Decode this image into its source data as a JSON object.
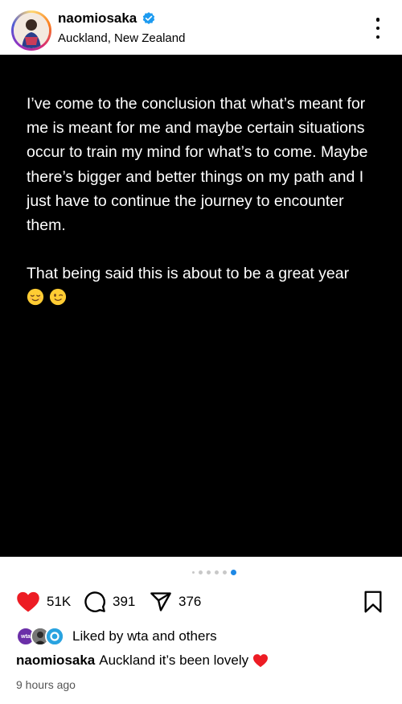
{
  "header": {
    "username": "naomiosaka",
    "location": "Auckland, New Zealand",
    "verified_icon": "verified-badge-icon",
    "more_icon": "more-vertical-icon"
  },
  "post": {
    "text": "I’ve come to the conclusion that what’s meant for me is meant for me and maybe certain situations occur to train my mind for what’s to come. Maybe there’s bigger and better things on my path and I just have to continue the journey to encounter them.\n\nThat being said this is about to be a great year",
    "emojis": [
      "relieved-face-emoji",
      "winking-face-emoji"
    ]
  },
  "carousel": {
    "count": 6,
    "active_index": 5
  },
  "actions": {
    "likes": "51K",
    "comments": "391",
    "shares": "376"
  },
  "liked_by": {
    "prefix": "Liked by",
    "user": "wta",
    "suffix": "and others",
    "wta_avatar_text": "wta"
  },
  "caption": {
    "username": "naomiosaka",
    "text": "Auckland it’s been lovely"
  },
  "timestamp": "9 hours ago",
  "colors": {
    "heart": "#ed1c24",
    "verified": "#1d9bf0",
    "active_dot": "#1e88e5"
  }
}
